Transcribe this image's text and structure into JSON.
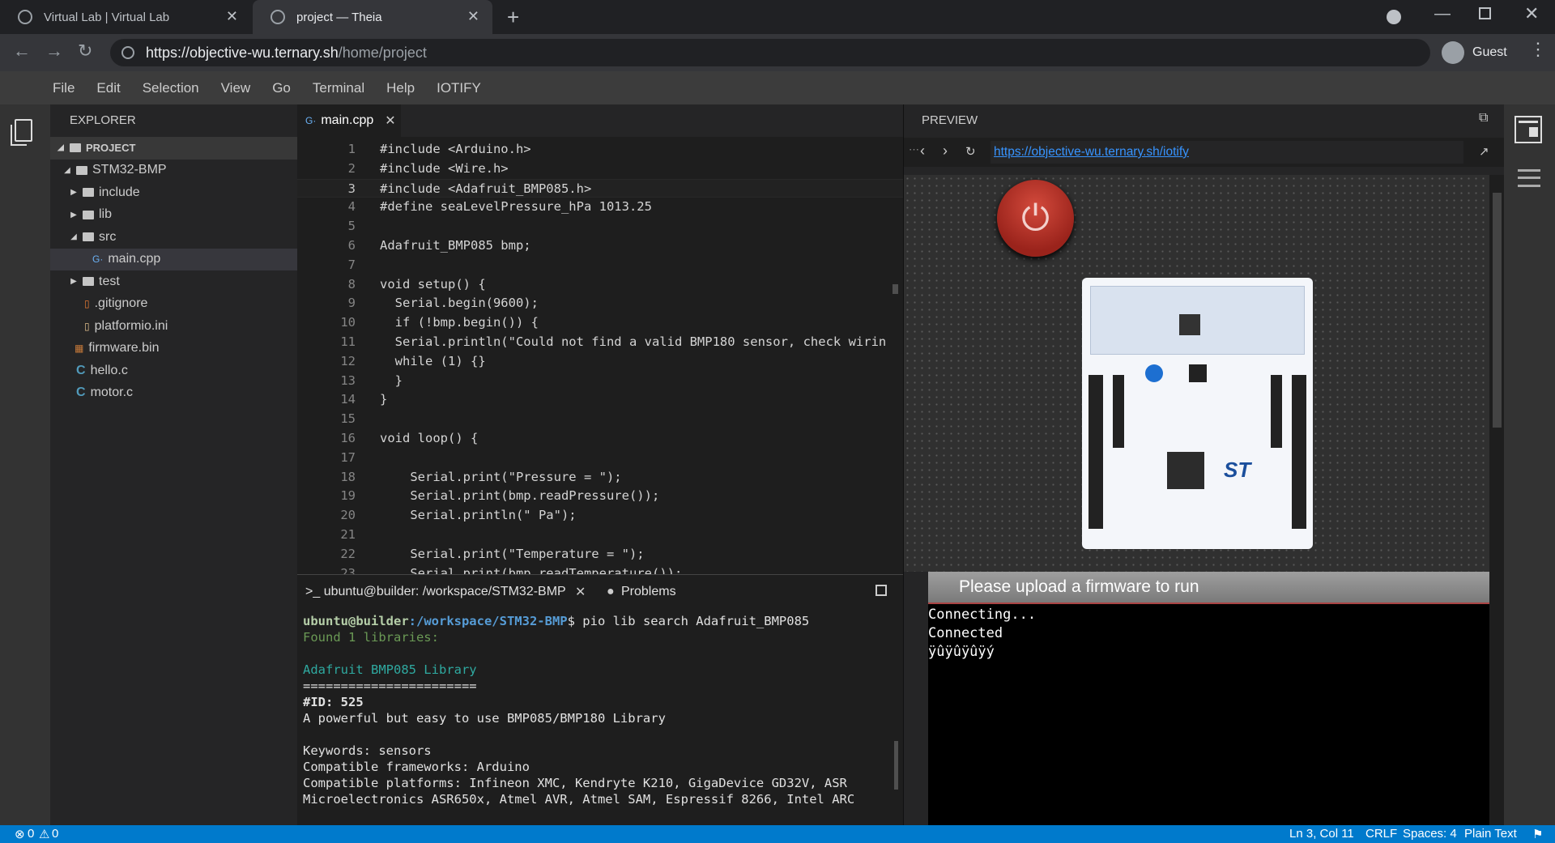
{
  "browser": {
    "tabs": [
      {
        "title": "Virtual Lab | Virtual Lab",
        "active": false
      },
      {
        "title": "project — Theia",
        "active": true
      }
    ],
    "new_tab_icon": "plus-icon",
    "url_host": "https://objective-wu.ternary.sh",
    "url_path": "/home/project",
    "profile_label": "Guest"
  },
  "menu": [
    "File",
    "Edit",
    "Selection",
    "View",
    "Go",
    "Terminal",
    "Help",
    "IOTIFY"
  ],
  "explorer": {
    "title": "EXPLORER",
    "root": "PROJECT",
    "nodes": [
      {
        "label": "STM32-BMP",
        "type": "folder-open",
        "depth": 1
      },
      {
        "label": "include",
        "type": "folder",
        "depth": 2
      },
      {
        "label": "lib",
        "type": "folder",
        "depth": 2
      },
      {
        "label": "src",
        "type": "folder-open",
        "depth": 2
      },
      {
        "label": "main.cpp",
        "type": "file-cpp",
        "depth": 3,
        "selected": true
      },
      {
        "label": "test",
        "type": "folder",
        "depth": 2
      },
      {
        "label": ".gitignore",
        "type": "file-git",
        "depth": 2
      },
      {
        "label": "platformio.ini",
        "type": "file-ini",
        "depth": 2
      },
      {
        "label": "firmware.bin",
        "type": "file-bin",
        "depth": 1
      },
      {
        "label": "hello.c",
        "type": "file-c",
        "depth": 1
      },
      {
        "label": "motor.c",
        "type": "file-c",
        "depth": 1
      }
    ]
  },
  "editor": {
    "tab": "main.cpp",
    "current_line": 3,
    "lines": [
      "#include <Arduino.h>",
      "#include <Wire.h>",
      "#include <Adafruit_BMP085.h>",
      "#define seaLevelPressure_hPa 1013.25",
      "",
      "Adafruit_BMP085 bmp;",
      "",
      "void setup() {",
      "  Serial.begin(9600);",
      "  if (!bmp.begin()) {",
      "  Serial.println(\"Could not find a valid BMP180 sensor, check wirin",
      "  while (1) {}",
      "  }",
      "}",
      "",
      "void loop() {",
      "",
      "    Serial.print(\"Pressure = \");",
      "    Serial.print(bmp.readPressure());",
      "    Serial.println(\" Pa\");",
      "",
      "    Serial.print(\"Temperature = \");",
      "    Serial.print(bmp.readTemperature());"
    ]
  },
  "terminal": {
    "tab_label": ">_ ubuntu@builder: /workspace/STM32-BMP",
    "problems_label": "Problems",
    "prompt_user": "ubuntu@builder",
    "prompt_path": ":/workspace/STM32-BMP",
    "command": "$ pio lib search Adafruit_BMP085",
    "found": "Found 1 libraries:",
    "lib_name": "Adafruit BMP085 Library",
    "underline": "=======================",
    "lib_id": "#ID: 525",
    "lib_desc": "A powerful but easy to use BMP085/BMP180 Library",
    "keywords": "Keywords: sensors",
    "frameworks": "Compatible frameworks: Arduino",
    "platforms1": "Compatible platforms: Infineon XMC, Kendryte K210, GigaDevice GD32V, ASR",
    "platforms2": "Microelectronics ASR650x, Atmel AVR, Atmel SAM, Espressif 8266, Intel ARC"
  },
  "preview": {
    "title": "PREVIEW",
    "url": "https://objective-wu.ternary.sh/iotify",
    "firmware_msg": "Please upload a firmware to run",
    "serial_lines": [
      "Connecting...",
      "Connected",
      "ÿûÿûÿûÿý"
    ],
    "board_logo": "ST"
  },
  "status": {
    "errors": "0",
    "warnings": "0",
    "position": "Ln 3, Col 11",
    "eol": "CRLF",
    "spaces": "Spaces: 4",
    "language": "Plain Text"
  },
  "colors": {
    "accent": "#007acc",
    "power_button": "#b5312a",
    "link": "#3794ff"
  }
}
